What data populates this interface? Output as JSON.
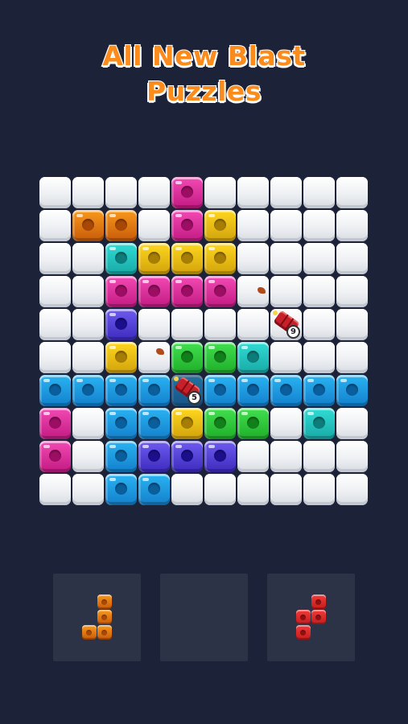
{
  "title": {
    "line1": "All New Blast",
    "line2": "Puzzles"
  },
  "colors": {
    "E": null,
    "O": [
      "#f99a1d",
      "#c75a0a",
      "#a94806"
    ],
    "P": [
      "#f34ab5",
      "#c21a82",
      "#9c0e63"
    ],
    "Y": [
      "#ffd81f",
      "#d1a20c",
      "#a77e05"
    ],
    "T": [
      "#31dcd5",
      "#18a9a6",
      "#0d7c7a"
    ],
    "U": [
      "#6f5bf0",
      "#3c2bbd",
      "#1c0f8c"
    ],
    "G": [
      "#42e04f",
      "#1fae2a",
      "#12801a"
    ],
    "B": [
      "#2ab4f2",
      "#137fcc",
      "#0a5e9c"
    ],
    "R": [
      "#f23b3b",
      "#c31d1d",
      "#8f1010"
    ]
  },
  "board": {
    "rows": [
      [
        "E",
        "E",
        "E",
        "E",
        "P",
        "E",
        "E",
        "E",
        "E",
        "E"
      ],
      [
        "E",
        "O",
        "O",
        "E",
        "P",
        "Y",
        "E",
        "E",
        "E",
        "E"
      ],
      [
        "E",
        "E",
        "T",
        "Y",
        "Y",
        "Y",
        "E",
        "E",
        "E",
        "E"
      ],
      [
        "E",
        "E",
        "P",
        "P",
        "P",
        "P",
        "E",
        "E",
        "E",
        "E"
      ],
      [
        "E",
        "E",
        "U",
        "E",
        "E",
        "E",
        "E",
        "X9",
        "E",
        "E"
      ],
      [
        "E",
        "E",
        "Y",
        "E",
        "G",
        "G",
        "T",
        "E",
        "E",
        "E"
      ],
      [
        "B",
        "B",
        "B",
        "B",
        "X5",
        "B",
        "B",
        "B",
        "B",
        "B"
      ],
      [
        "P",
        "E",
        "B",
        "B",
        "Y",
        "G",
        "G",
        "E",
        "T",
        "E"
      ],
      [
        "P",
        "E",
        "B",
        "U",
        "U",
        "U",
        "E",
        "E",
        "E",
        "E"
      ],
      [
        "E",
        "E",
        "B",
        "B",
        "E",
        "E",
        "E",
        "E",
        "E",
        "E"
      ]
    ],
    "bombs": [
      {
        "row": 4,
        "col": 7,
        "count": "9"
      },
      {
        "row": 6,
        "col": 4,
        "count": "5"
      }
    ]
  },
  "pieces": [
    {
      "name": "orange-j-piece",
      "color": "O",
      "cells": [
        [
          0,
          1
        ],
        [
          1,
          1
        ],
        [
          2,
          0
        ],
        [
          2,
          1
        ]
      ]
    },
    {
      "name": "empty-slot",
      "color": null,
      "cells": []
    },
    {
      "name": "red-s-piece",
      "color": "R",
      "cells": [
        [
          0,
          1
        ],
        [
          1,
          0
        ],
        [
          1,
          1
        ],
        [
          2,
          0
        ]
      ]
    }
  ]
}
